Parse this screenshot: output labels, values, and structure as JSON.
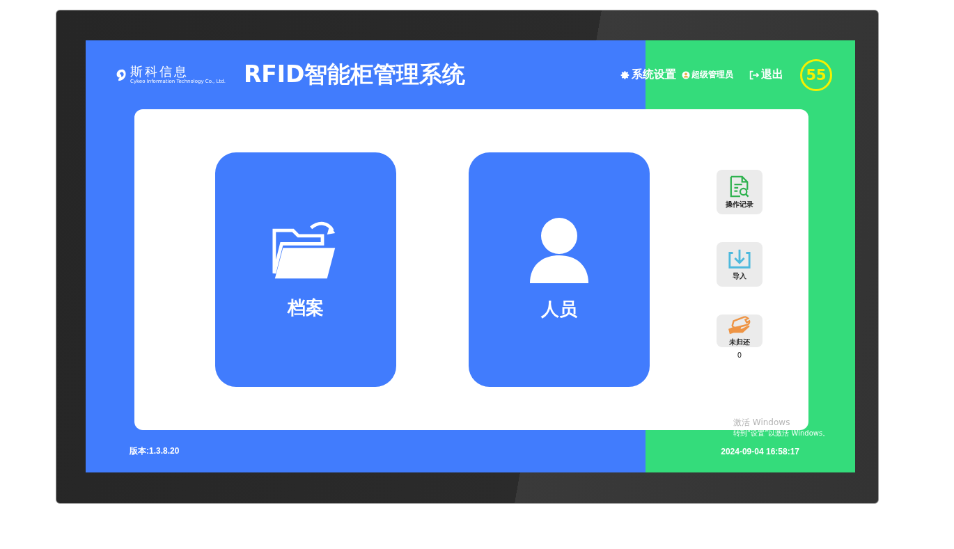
{
  "logo": {
    "name": "斯科信息",
    "subtitle": "Cykeo Information Technology Co., Ltd."
  },
  "title": "RFID智能柜管理系统",
  "header_actions": [
    {
      "kind": "settings",
      "label": "系统设置"
    },
    {
      "kind": "user",
      "label": "超级管理员"
    },
    {
      "kind": "logout",
      "label": "退出"
    }
  ],
  "countdown": "55",
  "tiles": [
    {
      "kind": "folder",
      "label": "档案"
    },
    {
      "kind": "person",
      "label": "人员"
    }
  ],
  "side_actions": [
    {
      "kind": "log",
      "label": "操作记录"
    },
    {
      "kind": "import",
      "label": "导入"
    },
    {
      "kind": "unreturned",
      "label": "未归还",
      "count": "0"
    }
  ],
  "version": "版本:1.3.8.20",
  "datetime": "2024-09-04 16:58:17",
  "activation_notice": [
    "激活 Windows",
    "转到“设置”以激活 Windows。"
  ]
}
